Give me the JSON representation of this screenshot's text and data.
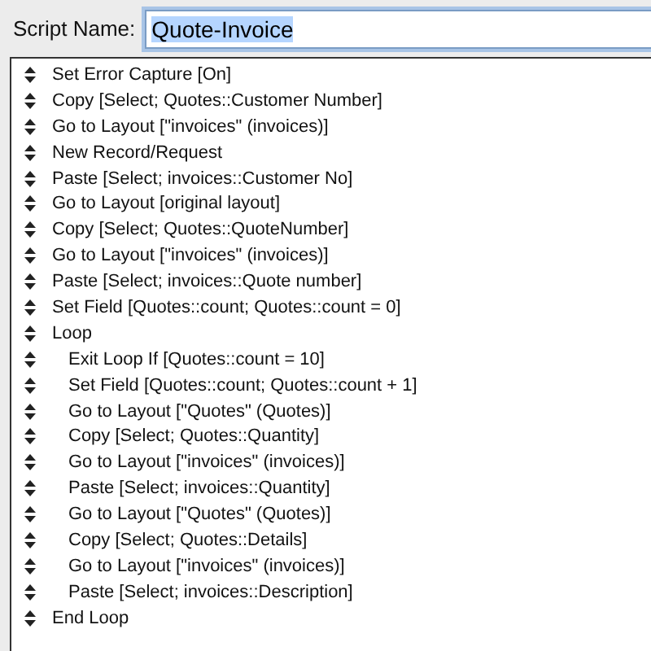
{
  "script_name": {
    "label": "Script Name:",
    "value": "Quote-Invoice",
    "text_selected": true
  },
  "steps": [
    {
      "text": "Set Error Capture [On]"
    },
    {
      "text": "Copy [Select; Quotes::Customer Number]"
    },
    {
      "text": "Go to Layout [\"invoices\" (invoices)]"
    },
    {
      "text": "New Record/Request"
    },
    {
      "text": "Paste [Select; invoices::Customer No]"
    },
    {
      "text": "Go to Layout [original layout]"
    },
    {
      "text": "Copy [Select; Quotes::QuoteNumber]"
    },
    {
      "text": "Go to Layout [\"invoices\" (invoices)]"
    },
    {
      "text": "Paste [Select; invoices::Quote number]"
    },
    {
      "text": "Set Field [Quotes::count; Quotes::count = 0]"
    },
    {
      "text": "Loop",
      "children": [
        {
          "text": "Exit Loop If [Quotes::count = 10]"
        },
        {
          "text": "Set Field [Quotes::count; Quotes::count + 1]"
        },
        {
          "text": "Go to Layout [\"Quotes\" (Quotes)]"
        },
        {
          "text": "Copy [Select; Quotes::Quantity]"
        },
        {
          "text": "Go to Layout [\"invoices\" (invoices)]"
        },
        {
          "text": "Paste [Select; invoices::Quantity]"
        },
        {
          "text": "Go to Layout [\"Quotes\" (Quotes)]"
        },
        {
          "text": "Copy [Select; Quotes::Details]"
        },
        {
          "text": "Go to Layout [\"invoices\" (invoices)]"
        },
        {
          "text": "Paste [Select; invoices::Description]"
        }
      ]
    },
    {
      "text": "End Loop"
    }
  ]
}
